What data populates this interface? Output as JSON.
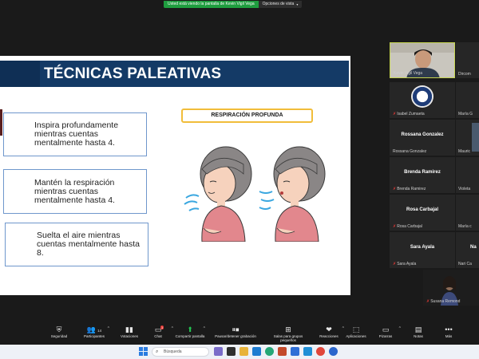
{
  "share_banner": {
    "text": "Usted está viendo la pantalla de Kevin Vigil Vega",
    "options": "Opciones de vista"
  },
  "slide": {
    "title": "TÉCNICAS PALEATIVAS",
    "label": "RESPIRACIÓN PROFUNDA",
    "steps": [
      [
        "Inspira profundamente",
        "mientras cuentas",
        "mentalmente hasta 4."
      ],
      [
        "Mantén la respiración",
        "mientras cuentas",
        "mentalmente hasta 4."
      ],
      [
        "Suelta el aire mientras",
        "cuentas mentalmente hasta",
        "8."
      ]
    ]
  },
  "gallery": {
    "tiles": [
      {
        "label": "Kevin Vigil Vega",
        "center": ""
      },
      {
        "label": "Dircom",
        "center": ""
      },
      {
        "label": "Isabel Zumaeta",
        "center": ""
      },
      {
        "label": "María G",
        "center": ""
      },
      {
        "label": "Rossana Gonzalez",
        "center": "Rossana Gonzalez"
      },
      {
        "label": "Mauric",
        "center": ""
      },
      {
        "label": "Brenda Ramirez",
        "center": "Brenda Ramirez"
      },
      {
        "label": "Violeta",
        "center": ""
      },
      {
        "label": "Rosa Carbajal",
        "center": "Rosa Carbajal"
      },
      {
        "label": "María c",
        "center": ""
      },
      {
        "label": "Sara Ayala",
        "center": "Sara Ayala"
      },
      {
        "label": "Nari Ca",
        "center": "Na"
      },
      {
        "label": "Susana Remond",
        "center": ""
      }
    ]
  },
  "toolbar": {
    "security": "Seguridad",
    "participants": "Participantes",
    "participants_count": "14",
    "polls": "Votaciones",
    "chat": "Chat",
    "chat_badge": "1",
    "share": "Compartir pantalla",
    "record": "Pausar/detener grabación",
    "breakout": "Salas para grupos pequeños",
    "reactions": "Reacciones",
    "apps": "Aplicaciones",
    "whiteboards": "Pizarras",
    "notes": "Notas",
    "more": "Más"
  },
  "taskbar": {
    "search_placeholder": "Búsqueda"
  },
  "colors": {
    "title_bar": "#143a66",
    "label_border": "#f1bd3a",
    "step_border": "#6f97cc",
    "share_green": "#1f9d3f",
    "active_tile": "#c4d34f"
  },
  "icons": [
    "shield-icon",
    "people-icon",
    "chart-icon",
    "chat-icon",
    "share-screen-icon",
    "pause-record-icon",
    "grid-icon",
    "heart-icon",
    "apps-icon",
    "whiteboard-icon",
    "notes-icon",
    "more-icon",
    "windows-icon",
    "search-icon"
  ]
}
